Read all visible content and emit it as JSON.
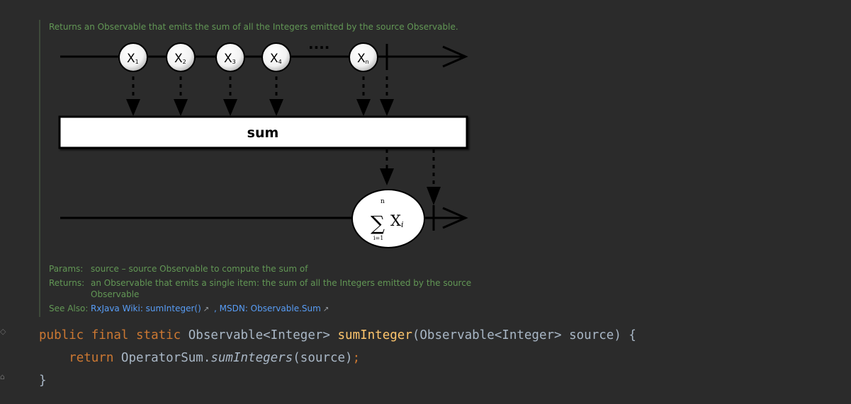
{
  "doc": {
    "summary": "Returns an Observable that emits the sum of all the Integers emitted by the source Observable.",
    "diagram": {
      "items": [
        {
          "base": "X",
          "sub": "1"
        },
        {
          "base": "X",
          "sub": "2"
        },
        {
          "base": "X",
          "sub": "3"
        },
        {
          "base": "X",
          "sub": "4"
        },
        {
          "base": "X",
          "sub": "n"
        }
      ],
      "operator_label": "sum",
      "result": {
        "upper": "n",
        "sigma": "∑",
        "term": "X",
        "index": "i",
        "lower": "i=1"
      }
    },
    "params_label": "Params:",
    "params_value": "source – source Observable to compute the sum of",
    "returns_label": "Returns:",
    "returns_value_line1": "an Observable that emits a single item: the sum of all the Integers emitted by the source",
    "returns_value_line2": "Observable",
    "see_also_label": "See Also:",
    "see_also_links": [
      "RxJava Wiki: sumInteger()",
      "MSDN: Observable.Sum"
    ],
    "see_also_sep": " ,"
  },
  "code": {
    "line1": {
      "kw1": "public",
      "kw2": "final",
      "kw3": "static",
      "ret_type": "Observable<Integer>",
      "method": "sumInteger",
      "params": "(Observable<Integer> source) {"
    },
    "line2": {
      "kw": "return",
      "target": "OperatorSum.",
      "call": "sumIntegers",
      "args": "(source)",
      "semi": ";"
    },
    "line3": "}"
  },
  "colors": {
    "background": "#2b2b2b",
    "doc_text": "#629755",
    "link": "#589df6",
    "keyword": "#cc7832",
    "method": "#ffc66d",
    "default_text": "#a9b7c6"
  }
}
